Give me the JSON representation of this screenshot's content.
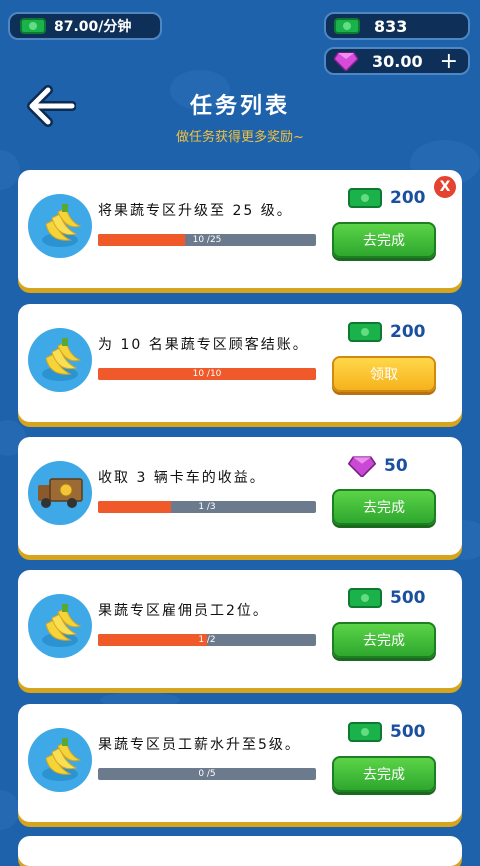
{
  "hud": {
    "income_rate": "87.00/分钟",
    "cash": "833",
    "gems": "30.00",
    "add_gems_symbol": "+"
  },
  "header": {
    "title": "任务列表",
    "subtitle": "做任务获得更多奖励~"
  },
  "colors": {
    "background": "#1d62aa",
    "progress_fill": "#f05a2a",
    "button_green": "#2ea72e",
    "button_yellow": "#f6b21d"
  },
  "tasks": [
    {
      "text": "将果蔬专区升级至 25 级。",
      "progress_label": "10 /25",
      "progress": 0.4,
      "reward": "200",
      "reward_icon": "cash-icon",
      "task_icon": "banana-icon",
      "button": "去完成",
      "button_style": "green"
    },
    {
      "text": "为 10 名果蔬专区顾客结账。",
      "progress_label": "10 /10",
      "progress": 1.0,
      "reward": "200",
      "reward_icon": "cash-icon",
      "task_icon": "banana-icon",
      "button": "领取",
      "button_style": "yellow"
    },
    {
      "text": "收取 3 辆卡车的收益。",
      "progress_label": "1 /3",
      "progress": 0.333,
      "reward": "50",
      "reward_icon": "gem-icon",
      "task_icon": "truck-icon",
      "button": "去完成",
      "button_style": "green"
    },
    {
      "text": "果蔬专区雇佣员工2位。",
      "progress_label": "1 /2",
      "progress": 0.5,
      "reward": "500",
      "reward_icon": "cash-icon",
      "task_icon": "banana-icon",
      "button": "去完成",
      "button_style": "green"
    },
    {
      "text": "果蔬专区员工薪水升至5级。",
      "progress_label": "0 /5",
      "progress": 0.0,
      "reward": "500",
      "reward_icon": "cash-icon",
      "task_icon": "banana-icon",
      "button": "去完成",
      "button_style": "green"
    }
  ],
  "close_symbol": "X"
}
